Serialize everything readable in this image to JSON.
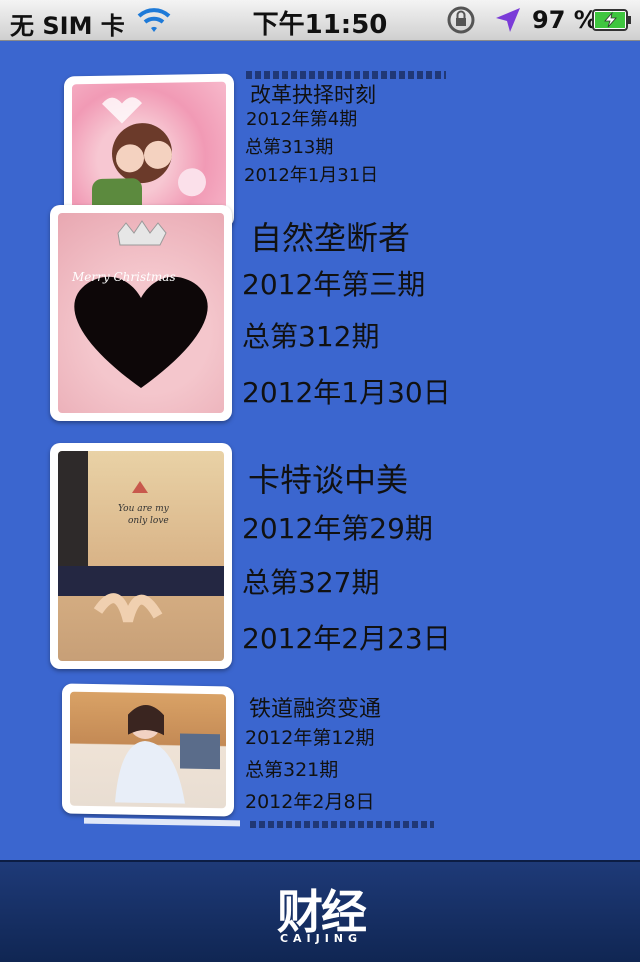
{
  "status_bar": {
    "carrier": "无 SIM 卡",
    "time": "下午11:50",
    "battery": "97 %"
  },
  "issues": [
    {
      "title": "改革抉择时刻",
      "issue": "2012年第4期",
      "total": "总第313期",
      "date": "2012年1月31日"
    },
    {
      "title": "自然垄断者",
      "issue": "2012年第三期",
      "total": "总第312期",
      "date": "2012年1月30日"
    },
    {
      "title": "卡特谈中美",
      "issue": "2012年第29期",
      "total": "总第327期",
      "date": "2012年2月23日"
    },
    {
      "title": "铁道融资变通",
      "issue": "2012年第12期",
      "total": "总第321期",
      "date": "2012年2月8日"
    }
  ],
  "brand": {
    "name": "财经",
    "sub": "CAIJING"
  }
}
